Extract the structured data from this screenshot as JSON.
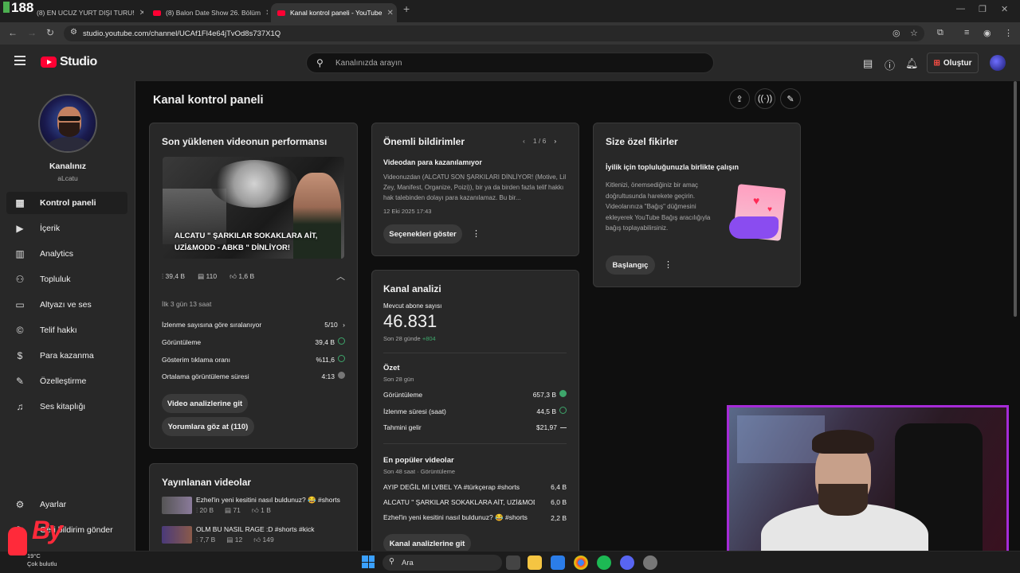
{
  "browser": {
    "badge": "188",
    "tabs": [
      {
        "title": "(8) EN UCUZ YURT DIŞI TURU!"
      },
      {
        "title": "(8) Balon Date Show 26. Bölüm"
      },
      {
        "title": "Kanal kontrol paneli - YouTube"
      }
    ],
    "url": "studio.youtube.com/channel/UCAf1Fl4e64jTvOd8s737X1Q"
  },
  "header": {
    "logo_text": "Studio",
    "search_placeholder": "Kanalınızda arayın",
    "create_label": "Oluştur"
  },
  "sidebar": {
    "channel_label": "Kanalınız",
    "channel_handle": "aLcatu",
    "items": [
      {
        "label": "Kontrol paneli",
        "icon": "dashboard-icon"
      },
      {
        "label": "İçerik",
        "icon": "content-icon"
      },
      {
        "label": "Analytics",
        "icon": "analytics-icon"
      },
      {
        "label": "Topluluk",
        "icon": "community-icon"
      },
      {
        "label": "Altyazı ve ses",
        "icon": "subtitles-icon"
      },
      {
        "label": "Telif hakkı",
        "icon": "copyright-icon"
      },
      {
        "label": "Para kazanma",
        "icon": "monetization-icon"
      },
      {
        "label": "Özelleştirme",
        "icon": "customization-icon"
      },
      {
        "label": "Ses kitaplığı",
        "icon": "audio-library-icon"
      }
    ],
    "settings_label": "Ayarlar",
    "feedback_label": "Geri bildirim gönder"
  },
  "main": {
    "title": "Kanal kontrol paneli"
  },
  "performance": {
    "title": "Son yüklenen videonun performansı",
    "thumb_caption": "ALCATU \" ŞARKILAR SOKAKLARA AİT, UZİ&MODD - ABKB \" DİNLİYOR!",
    "views": "39,4 B",
    "comments": "110",
    "likes": "1,6 B",
    "period": "İlk 3 gün 13 saat",
    "rows": [
      {
        "label": "İzlenme sayısına göre sıralanıyor",
        "value": "5/10",
        "status": "chevron"
      },
      {
        "label": "Görüntüleme",
        "value": "39,4 B",
        "status": "ok"
      },
      {
        "label": "Gösterim tıklama oranı",
        "value": "%11,6",
        "status": "ok"
      },
      {
        "label": "Ortalama görüntüleme süresi",
        "value": "4:13",
        "status": "neutral"
      }
    ],
    "btn_analytics": "Video analizlerine git",
    "btn_comments": "Yorumlara göz at (110)"
  },
  "published": {
    "title": "Yayınlanan videolar",
    "videos": [
      {
        "title": "Ezhel'in yeni kesitini nasıl buldunuz? 😂 #shorts",
        "views": "20 B",
        "comments": "71",
        "likes": "1 B"
      },
      {
        "title": "OLM BU NASIL RAGE :D #shorts #kick",
        "views": "7,7 B",
        "comments": "12",
        "likes": "149"
      }
    ]
  },
  "notices": {
    "title": "Önemli bildirimler",
    "pager": "1 / 6",
    "heading": "Videodan para kazanılamıyor",
    "body": "Videonuzdan (ALCATU SON ŞARKILARI DİNLİYOR! (Motive, Lil Zey, Manifest, Organize, Poizi)), bir ya da birden fazla telif hakkı hak talebinden dolayı para kazanılamaz. Bu bir...",
    "date": "12 Eki 2025 17:43",
    "btn": "Seçenekleri göster"
  },
  "analytics": {
    "title": "Kanal analizi",
    "subs_label": "Mevcut abone sayısı",
    "subs_value": "46.831",
    "subs_period": "Son 28 günde",
    "subs_delta": "+804",
    "summary_title": "Özet",
    "summary_period": "Son 28 gün",
    "summary_rows": [
      {
        "label": "Görüntüleme",
        "value": "657,3 B",
        "status": "up"
      },
      {
        "label": "İzlenme süresi (saat)",
        "value": "44,5 B",
        "status": "ok"
      },
      {
        "label": "Tahmini gelir",
        "value": "$21,97",
        "status": "dash"
      }
    ],
    "popular_title": "En popüler videolar",
    "popular_period": "Son 48 saat · Görüntüleme",
    "popular": [
      {
        "title": "AYIP DEĞİL Mİ LVBEL YA #türkçerap #shorts",
        "value": "6,4 B"
      },
      {
        "title": "ALCATU \" ŞARKILAR SOKAKLARA AİT, UZİ&MODD - ...",
        "value": "6,0 B"
      },
      {
        "title": "Ezhel'in yeni kesitini nasıl buldunuz? 😂 #shorts",
        "value": "2,2 B"
      }
    ],
    "btn": "Kanal analizlerine git"
  },
  "ideas": {
    "title": "Size özel fikirler",
    "heading": "İyilik için topluluğunuzla birlikte çalışın",
    "body": "Kitlenizi, önemsediğiniz bir amaç doğrultusunda harekete geçirin. Videolarınıza \"Bağış\" düğmesini ekleyerek YouTube Bağış aracılığıyla bağış toplayabilirsiniz.",
    "btn": "Başlangıç"
  },
  "taskbar": {
    "search": "Ara",
    "weather_temp": "19°C",
    "weather_desc": "Çok bulutlu"
  },
  "overlay": {
    "by_text": "By"
  },
  "colors": {
    "accent_red": "#ff0033",
    "ok_green": "#3ea66b",
    "cam_border": "#a62bd8"
  }
}
